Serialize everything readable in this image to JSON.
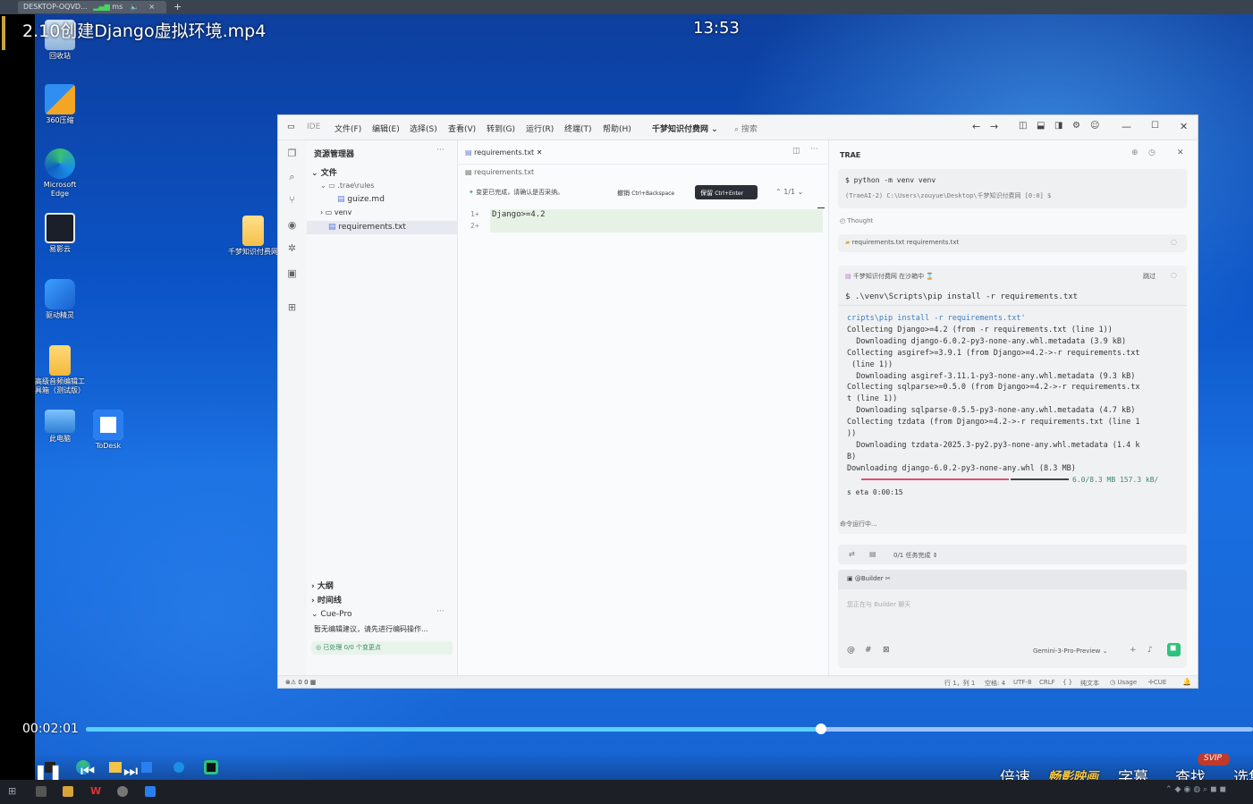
{
  "remote_tab": {
    "label": "DESKTOP-OQVD...",
    "signal": "ms",
    "plus": "+"
  },
  "video": {
    "title": "2.10创建Django虚拟环境.mp4",
    "clock": "13:53",
    "elapsed": "00:02:01",
    "progress": 0.63
  },
  "desktop_icons": [
    {
      "label": "回收站"
    },
    {
      "label": "360压缩"
    },
    {
      "label": "Microsoft Edge"
    },
    {
      "label": "易影云"
    },
    {
      "label": "驱动精灵"
    },
    {
      "label": "高级音频编辑工具箱（测试版）"
    },
    {
      "label": "此电脑"
    },
    {
      "label": "ToDesk"
    },
    {
      "label": "千梦知识付费网"
    }
  ],
  "ide": {
    "app_label": "IDE",
    "menus": [
      "文件(F)",
      "编辑(E)",
      "选择(S)",
      "查看(V)",
      "转到(G)",
      "运行(R)",
      "终端(T)",
      "帮助(H)"
    ],
    "project_name": "千梦知识付费网",
    "search_label": "搜索",
    "explorer": {
      "title": "资源管理器",
      "section": "文件",
      "tree": [
        ".trae\\rules",
        "guize.md",
        "venv",
        "requirements.txt"
      ],
      "outline": "大纲",
      "timeline": "时间线",
      "cue_title": "Cue-Pro",
      "cue_text": "暂无编辑建议，请先进行编码操作...",
      "cue_status": "已处理 0/0 个变更点"
    },
    "editor": {
      "tab": "requirements.txt",
      "breadcrumb": "requirements.txt",
      "notice": "变更已完成，请确认是否采纳。",
      "undo_label": "撤销",
      "undo_key": "Ctrl+Backspace",
      "accept_label": "保留",
      "accept_key": "Ctrl+Enter",
      "counter": "1/1",
      "lines": [
        {
          "no": "1+",
          "text": "Django>=4.2"
        },
        {
          "no": "2+",
          "text": ""
        }
      ]
    },
    "chat": {
      "title": "TRAE",
      "cmd1": "$ python -m venv venv",
      "cmd1_out": "(TraeAI-2) C:\\Users\\zouyue\\Desktop\\千梦知识付费网 [0:0] $",
      "thought": "Thought",
      "file_ref": "requirements.txt requirements.txt",
      "term_header": "千梦知识付费网  在沙箱中 ⌛",
      "skip": "跳过",
      "cmd2": "$ .\\venv\\Scripts\\pip install -r requirements.txt",
      "output": [
        "cripts\\pip install -r requirements.txt'",
        "Collecting Django>=4.2 (from -r requirements.txt (line 1))",
        "  Downloading django-6.0.2-py3-none-any.whl.metadata (3.9 kB)",
        "Collecting asgiref>=3.9.1 (from Django>=4.2->-r requirements.txt",
        " (line 1))",
        "  Downloading asgiref-3.11.1-py3-none-any.whl.metadata (9.3 kB)",
        "Collecting sqlparse>=0.5.0 (from Django>=4.2->-r requirements.tx",
        "t (line 1))",
        "  Downloading sqlparse-0.5.5-py3-none-any.whl.metadata (4.7 kB)",
        "Collecting tzdata (from Django>=4.2->-r requirements.txt (line 1",
        "))",
        "  Downloading tzdata-2025.3-py2.py3-none-any.whl.metadata (1.4 k",
        "B)",
        "Downloading django-6.0.2-py3-none-any.whl (8.3 MB)"
      ],
      "download_progress": "6.0/8.3 MB 157.3 kB/",
      "eta": "s eta 0:00:15",
      "running": "命令运行中...",
      "tasks": "0/1 任务完成",
      "builder": "@Builder",
      "placeholder": "您正在与 Builder 聊天",
      "model": "Gemini-3-Pro-Preview"
    },
    "status": {
      "left": "0  0",
      "position": "行 1，列 1",
      "spaces": "空格: 4",
      "encoding": "UTF-8",
      "eol": "CRLF",
      "braces": "{ }",
      "lang": "纯文本",
      "usage": "Usage",
      "cue": "CUE"
    }
  },
  "player": {
    "speed": "倍速",
    "brand": "畅影映画",
    "subtitle": "字幕",
    "find": "查找",
    "svip": "SVIP",
    "more": "选集"
  }
}
